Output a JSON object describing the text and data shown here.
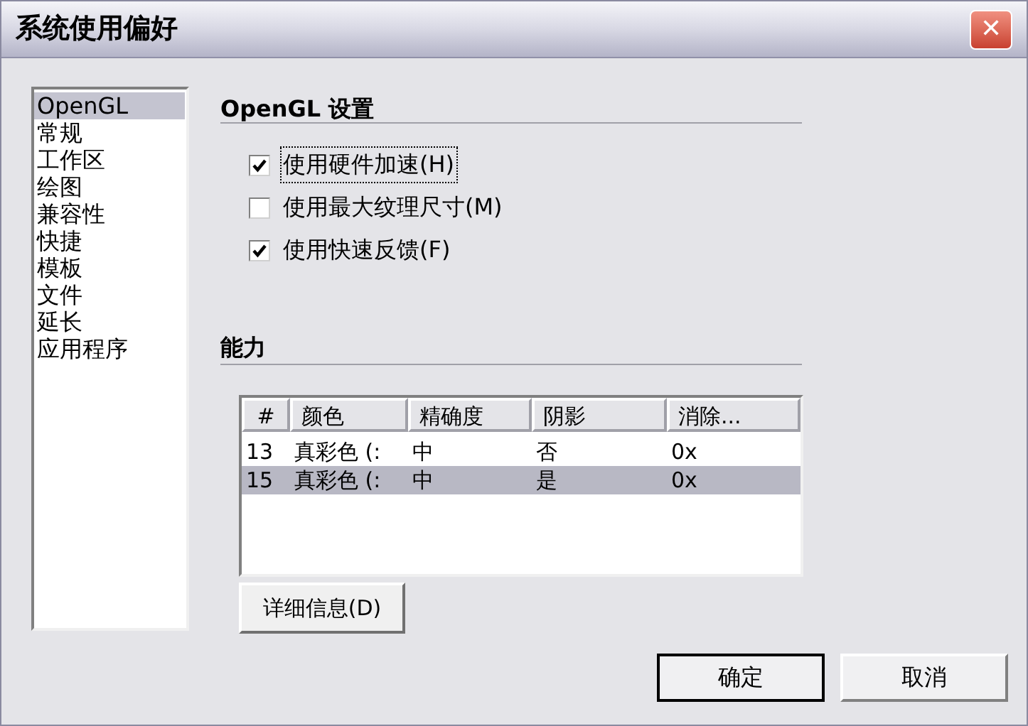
{
  "window": {
    "title": "系统使用偏好",
    "close": "✕"
  },
  "sidebar": {
    "items": [
      {
        "label": "OpenGL",
        "selected": true
      },
      {
        "label": "常规",
        "selected": false
      },
      {
        "label": "工作区",
        "selected": false
      },
      {
        "label": "绘图",
        "selected": false
      },
      {
        "label": "兼容性",
        "selected": false
      },
      {
        "label": "快捷",
        "selected": false
      },
      {
        "label": "模板",
        "selected": false
      },
      {
        "label": "文件",
        "selected": false
      },
      {
        "label": "延长",
        "selected": false
      },
      {
        "label": "应用程序",
        "selected": false
      }
    ]
  },
  "opengl_section": {
    "heading": "OpenGL 设置",
    "options": [
      {
        "label": "使用硬件加速(H)",
        "checked": true,
        "focused": true
      },
      {
        "label": "使用最大纹理尺寸(M)",
        "checked": false,
        "focused": false
      },
      {
        "label": "使用快速反馈(F)",
        "checked": true,
        "focused": false
      }
    ]
  },
  "capability_section": {
    "heading": "能力",
    "table": {
      "columns": [
        "#",
        "颜色",
        "精确度",
        "阴影",
        "消除..."
      ],
      "rows": [
        {
          "cells": [
            "13",
            "真彩色 (:",
            "中",
            "否",
            "0x"
          ],
          "selected": false
        },
        {
          "cells": [
            "15",
            "真彩色 (:",
            "中",
            "是",
            "0x"
          ],
          "selected": true
        }
      ]
    },
    "details_button": "详细信息(D)"
  },
  "buttons": [
    {
      "label": "确定",
      "default": true
    },
    {
      "label": "取消",
      "default": false
    }
  ]
}
